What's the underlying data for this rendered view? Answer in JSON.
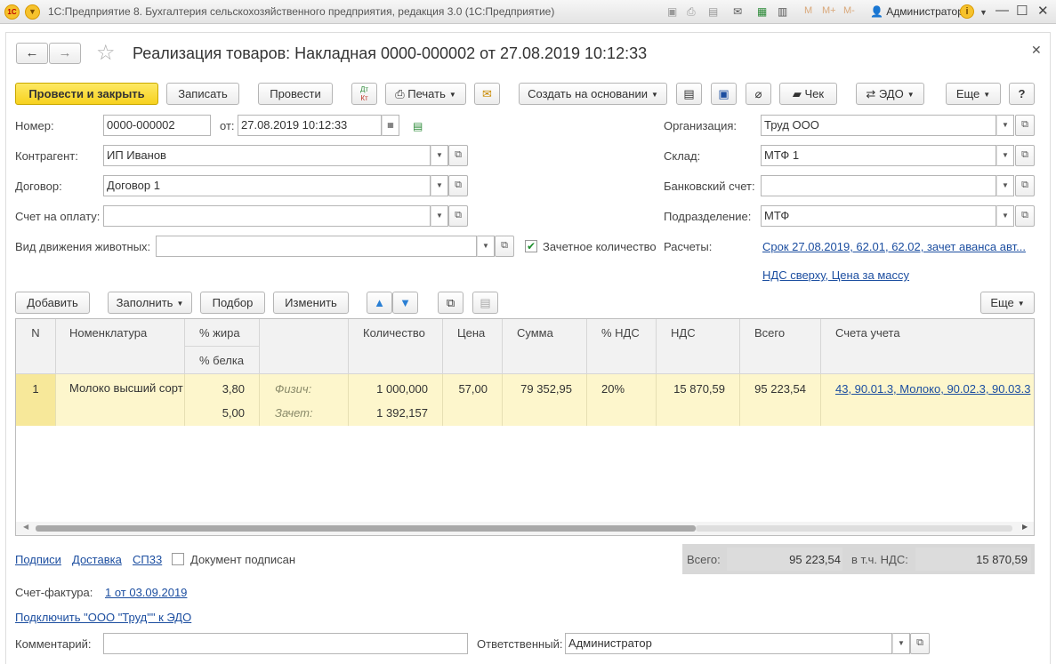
{
  "titlebar": {
    "logo": "1С",
    "title": "1С:Предприятие 8. Бухгалтерия сельскохозяйственного предприятия, редакция 3.0  (1С:Предприятие)",
    "m": "M",
    "m_plus": "M+",
    "m_minus": "M-",
    "user": "Администратор",
    "info": "i"
  },
  "header": {
    "title": "Реализация товаров: Накладная 0000-000002 от 27.08.2019 10:12:33"
  },
  "toolbar": {
    "post_close": "Провести и закрыть",
    "save": "Записать",
    "post": "Провести",
    "dt_kt_top": "Дт",
    "dt_kt_bottom": "Кт",
    "print": "Печать",
    "create_based": "Создать на основании",
    "check": "Чек",
    "edo": "ЭДО",
    "more": "Еще",
    "help": "?"
  },
  "form": {
    "number_label": "Номер:",
    "number_value": "0000-000002",
    "from_label": "от:",
    "date_value": "27.08.2019 10:12:33",
    "counterparty_label": "Контрагент:",
    "counterparty_value": "ИП Иванов",
    "contract_label": "Договор:",
    "contract_value": "Договор 1",
    "invoice_label": "Счет на оплату:",
    "invoice_value": "",
    "animal_label": "Вид движения животных:",
    "animal_value": "",
    "credit_qty_label": "Зачетное количество",
    "credit_qty_checked": true,
    "org_label": "Организация:",
    "org_value": "Труд ООО",
    "warehouse_label": "Склад:",
    "warehouse_value": "МТФ 1",
    "bank_label": "Банковский счет:",
    "bank_value": "",
    "dept_label": "Подразделение:",
    "dept_value": "МТФ",
    "settlements_label": "Расчеты:",
    "settlements_link": "Срок 27.08.2019, 62.01, 62.02, зачет аванса авт...",
    "vat_link": "НДС сверху, Цена за массу"
  },
  "table_toolbar": {
    "add": "Добавить",
    "fill": "Заполнить",
    "pick": "Подбор",
    "edit": "Изменить",
    "more": "Еще"
  },
  "table": {
    "headers": {
      "n": "N",
      "item": "Номенклатура",
      "fat": "% жира",
      "protein": "% белка",
      "qty": "Количество",
      "price": "Цена",
      "sum": "Сумма",
      "vat_pct": "% НДС",
      "vat": "НДС",
      "total": "Всего",
      "accounts": "Счета учета"
    },
    "rows": [
      {
        "n": "1",
        "item": "Молоко высший сорт",
        "fat": "3,80",
        "protein": "5,00",
        "phys_label": "Физич:",
        "credit_label": "Зачет:",
        "qty_phys": "1 000,000",
        "qty_credit": "1 392,157",
        "price": "57,00",
        "sum": "79 352,95",
        "vat_pct": "20%",
        "vat": "15 870,59",
        "total": "95 223,54",
        "accounts": "43, 90.01.3, Молоко, 90.02.3, 90.03.3"
      }
    ]
  },
  "footer": {
    "signatures": "Подписи",
    "delivery": "Доставка",
    "sp33": "СП33",
    "signed_label": "Документ подписан",
    "total_label": "Всего:",
    "total_value": "95 223,54",
    "vat_label": "в т.ч. НДС:",
    "vat_value": "15 870,59",
    "invoice_label": "Счет-фактура:",
    "invoice_link": "1 от 03.09.2019",
    "edo_link": "Подключить \"ООО \"Труд\"\" к ЭДО",
    "comment_label": "Комментарий:",
    "comment_value": "",
    "responsible_label": "Ответственный:",
    "responsible_value": "Администратор"
  }
}
